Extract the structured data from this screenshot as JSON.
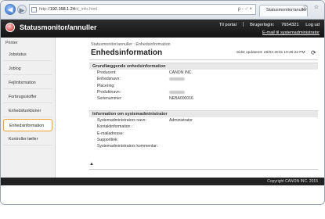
{
  "browser": {
    "url_prefix": "http://",
    "url_host": "192.168.1.24",
    "url_path": "/d_info.html",
    "url_tools": "ρ - ♂ ×",
    "tab_title": "Statusmonitor/anuller",
    "window_buttons": "☆ ☆"
  },
  "header": {
    "app_title": "Statusmonitor/annuller",
    "links": [
      "Til portal",
      "Brugerlogin:",
      "7654321",
      "Log ud"
    ],
    "mail_link": "E-mail til systemadministrator"
  },
  "sidebar": {
    "title": "Printer",
    "items": [
      {
        "label": "Jobstatus",
        "active": false
      },
      {
        "label": "Joblog",
        "active": false
      },
      {
        "label": "Fejlinformation",
        "active": false
      },
      {
        "label": "Forbrugsstoffer",
        "active": false
      },
      {
        "label": "Enhedsfunktioner",
        "active": false
      },
      {
        "label": "Enhedsinformation",
        "active": true
      },
      {
        "label": "Kontroller tæller",
        "active": false
      }
    ],
    "accent_color": "#f0a030"
  },
  "main": {
    "breadcrumb": "Statusmonitor/annuller : Enhedsinformation",
    "page_title": "Enhedsinformation",
    "updated": "Sidst opdateret: 26/04 2015 10:46:22 PM",
    "refresh_icon": "refresh-icon",
    "sections": [
      {
        "heading": "Grundlæggende enhedsinformation",
        "rows": [
          {
            "label": "Producent:",
            "value": "CANON INC."
          },
          {
            "label": "Enhedsnavn:",
            "value": ""
          },
          {
            "label": "Placering:",
            "value": ""
          },
          {
            "label": "Produktnavn:",
            "value": ""
          },
          {
            "label": "Serienummer:",
            "value": "NEBA000016"
          }
        ]
      },
      {
        "heading": "Information om systemadministrator",
        "rows": [
          {
            "label": "Systemadministrators navn:",
            "value": "Administrator"
          },
          {
            "label": "Kontaktinformation :",
            "value": ""
          },
          {
            "label": "E-mailadresse:",
            "value": ""
          },
          {
            "label": "Supportlink:",
            "value": ""
          },
          {
            "label": "Systemadministrators kommentar:",
            "value": ""
          }
        ]
      }
    ],
    "to_top": "▲"
  },
  "footer": {
    "copyright": "Copyright CANON INC. 2015"
  }
}
